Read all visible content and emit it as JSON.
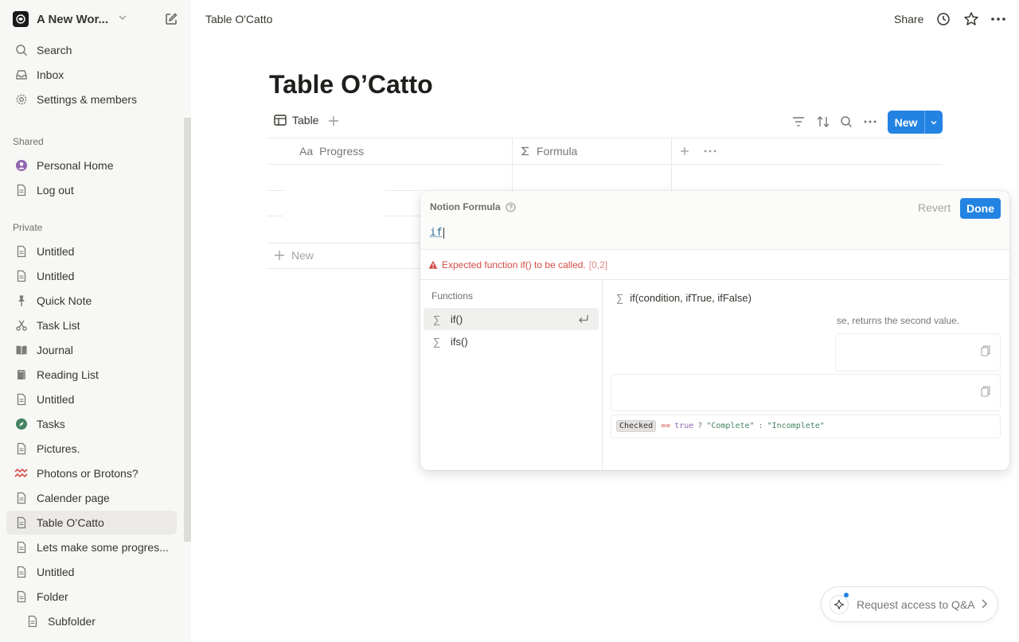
{
  "workspace": {
    "name": "A New Wor..."
  },
  "sidebar": {
    "top": [
      {
        "label": "Search",
        "icon": "search-icon"
      },
      {
        "label": "Inbox",
        "icon": "inbox-icon"
      },
      {
        "label": "Settings & members",
        "icon": "gear-icon"
      }
    ],
    "shared_label": "Shared",
    "shared": [
      {
        "label": "Personal Home",
        "icon": "person-icon"
      },
      {
        "label": "Log out",
        "icon": "page-icon"
      }
    ],
    "private_label": "Private",
    "private": [
      {
        "label": "Untitled",
        "icon": "page-icon"
      },
      {
        "label": "Untitled",
        "icon": "page-icon"
      },
      {
        "label": "Quick Note",
        "icon": "pin-icon"
      },
      {
        "label": "Task List",
        "icon": "scissors-icon"
      },
      {
        "label": "Journal",
        "icon": "book-open-icon"
      },
      {
        "label": "Reading List",
        "icon": "books-icon"
      },
      {
        "label": "Untitled",
        "icon": "page-icon"
      },
      {
        "label": "Tasks",
        "icon": "compass-icon"
      },
      {
        "label": "Pictures.",
        "icon": "page-icon"
      },
      {
        "label": "Photons or Brotons?",
        "icon": "wave-icon"
      },
      {
        "label": "Calender page",
        "icon": "page-icon"
      },
      {
        "label": "Table O’Catto",
        "icon": "page-icon"
      },
      {
        "label": "Lets make some progres...",
        "icon": "page-icon"
      },
      {
        "label": "Untitled",
        "icon": "page-icon"
      },
      {
        "label": "Folder",
        "icon": "page-icon"
      },
      {
        "label": "Subfolder",
        "icon": "page-icon"
      }
    ]
  },
  "topbar": {
    "title": "Table O'Catto",
    "share": "Share"
  },
  "page": {
    "title": "Table O’Catto",
    "view_tab": "Table",
    "new_button": "New",
    "columns": [
      {
        "prefix": "Aa",
        "label": "Progress"
      },
      {
        "label": "Formula"
      }
    ],
    "new_row": "New"
  },
  "formula": {
    "title": "Notion Formula",
    "revert": "Revert",
    "done": "Done",
    "input": "if",
    "error": "Expected function if() to be called.",
    "error_loc": "[0,2]",
    "functions_label": "Functions",
    "functions": [
      "if()",
      "ifs()"
    ],
    "signature": "if(condition, ifTrue, ifFalse)",
    "description": "se, returns the second value.",
    "example": {
      "prop": "Checked",
      "op": "==",
      "kw": "true",
      "q": "?",
      "str1": "\"Complete\"",
      "colon": ":",
      "str2": "\"Incomplete\""
    }
  },
  "qa": {
    "label": "Request access to Q&A"
  },
  "colors": {
    "accent": "#2383e2",
    "error": "#d44c47",
    "sidebar_bg": "#f7f7f5"
  }
}
